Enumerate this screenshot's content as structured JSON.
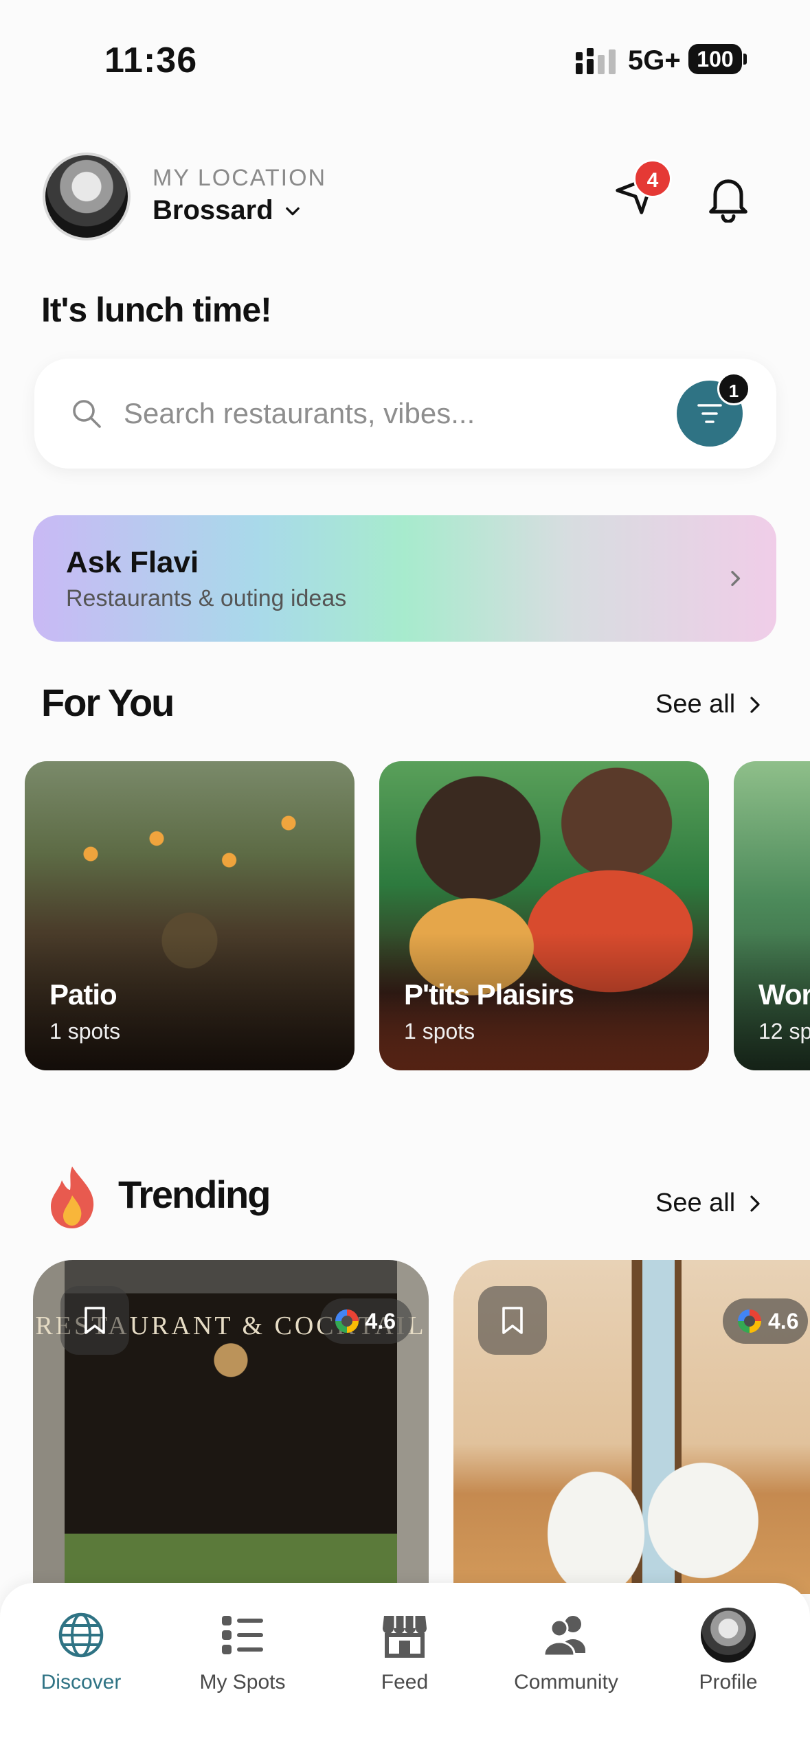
{
  "status_bar": {
    "time": "11:36",
    "network": "5G+",
    "battery": "100"
  },
  "header": {
    "location_label": "MY LOCATION",
    "location_value": "Brossard",
    "messages_badge": "4"
  },
  "greeting": "It's lunch time!",
  "search": {
    "placeholder": "Search restaurants, vibes...",
    "filter_badge": "1"
  },
  "ask_flavi": {
    "title": "Ask Flavi",
    "subtitle": "Restaurants & outing ideas"
  },
  "for_you": {
    "title": "For You",
    "see_all": "See all",
    "cards": [
      {
        "name": "Patio",
        "count": "1 spots"
      },
      {
        "name": "P'tits Plaisirs",
        "count": "1 spots"
      },
      {
        "name": "Wor",
        "count": "12 spo"
      }
    ]
  },
  "trending": {
    "title": "Trending",
    "see_all": "See all",
    "cards": [
      {
        "rating": "4.6",
        "sign": "RESTAURANT & COCKTAIL"
      },
      {
        "rating": "4.6"
      }
    ]
  },
  "tabbar": {
    "items": [
      {
        "label": "Discover",
        "icon": "globe-icon",
        "active": true
      },
      {
        "label": "My Spots",
        "icon": "list-icon"
      },
      {
        "label": "Feed",
        "icon": "storefront-icon"
      },
      {
        "label": "Community",
        "icon": "people-icon"
      },
      {
        "label": "Profile",
        "icon": "avatar"
      }
    ]
  },
  "colors": {
    "accent": "#2f7384",
    "badge_red": "#e53935"
  }
}
